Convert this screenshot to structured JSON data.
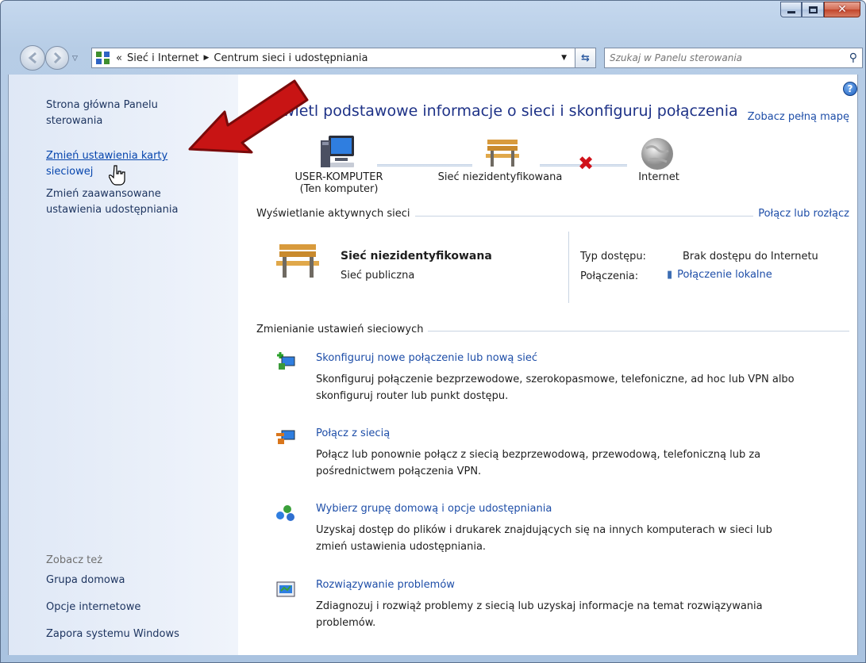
{
  "window": {
    "caption": {
      "minimize": "–",
      "maximize": "□",
      "close": "✕"
    }
  },
  "navbar": {
    "address": {
      "overflow": "«",
      "segments": [
        "Sieć i Internet",
        "Centrum sieci i udostępniania"
      ]
    },
    "search": {
      "placeholder": "Szukaj w Panelu sterowania"
    }
  },
  "sidebar": {
    "home": [
      "Strona główna Panelu",
      "sterowania"
    ],
    "change_adapter": [
      "Zmień ustawienia karty",
      "sieciowej"
    ],
    "advanced_sharing": [
      "Zmień zaawansowane",
      "ustawienia udostępniania"
    ],
    "see_also": "Zobacz też",
    "see_also_links": [
      "Grupa domowa",
      "Opcje internetowe",
      "Zapora systemu Windows"
    ]
  },
  "main": {
    "title": "Wyświetl podstawowe informacje o sieci i skonfiguruj połączenia",
    "title_visible": "świetl podstawowe informacje o sieci i skonfiguruj połączenia",
    "full_map": "Zobacz pełną mapę",
    "network_map": {
      "computer": [
        "USER-KOMPUTER",
        "(Ten komputer)"
      ],
      "network": "Sieć niezidentyfikowana",
      "internet": "Internet",
      "connection_ok": true,
      "internet_connected": false
    },
    "active_networks": {
      "title": "Wyświetlanie aktywnych sieci",
      "action": "Połącz lub rozłącz",
      "network_name": "Sieć niezidentyfikowana",
      "network_type": "Sieć publiczna",
      "access_type_label": "Typ dostępu:",
      "access_type_value": "Brak dostępu do Internetu",
      "connections_label": "Połączenia:",
      "connections_value": "Połączenie lokalne"
    },
    "change_settings": {
      "title": "Zmienianie ustawień sieciowych",
      "tasks": [
        {
          "title": "Skonfiguruj nowe połączenie lub nową sieć",
          "desc": [
            "Skonfiguruj połączenie bezprzewodowe, szerokopasmowe, telefoniczne, ad hoc lub VPN albo",
            "skonfiguruj router lub punkt dostępu."
          ]
        },
        {
          "title": "Połącz z siecią",
          "desc": [
            "Połącz lub ponownie połącz z siecią bezprzewodową, przewodową, telefoniczną lub za",
            "pośrednictwem połączenia VPN."
          ]
        },
        {
          "title": "Wybierz grupę domową i opcje udostępniania",
          "desc": [
            "Uzyskaj dostęp do plików i drukarek znajdujących się na innych komputerach w sieci lub",
            "zmień ustawienia udostępniania."
          ]
        },
        {
          "title": "Rozwiązywanie problemów",
          "desc": [
            "Zdiagnozuj i rozwiąż problemy z siecią lub uzyskaj informacje na temat rozwiązywania",
            "problemów."
          ]
        }
      ]
    }
  },
  "colors": {
    "link": "#1e4ea8",
    "title": "#1e3287",
    "annotation_arrow": "#c81414"
  }
}
